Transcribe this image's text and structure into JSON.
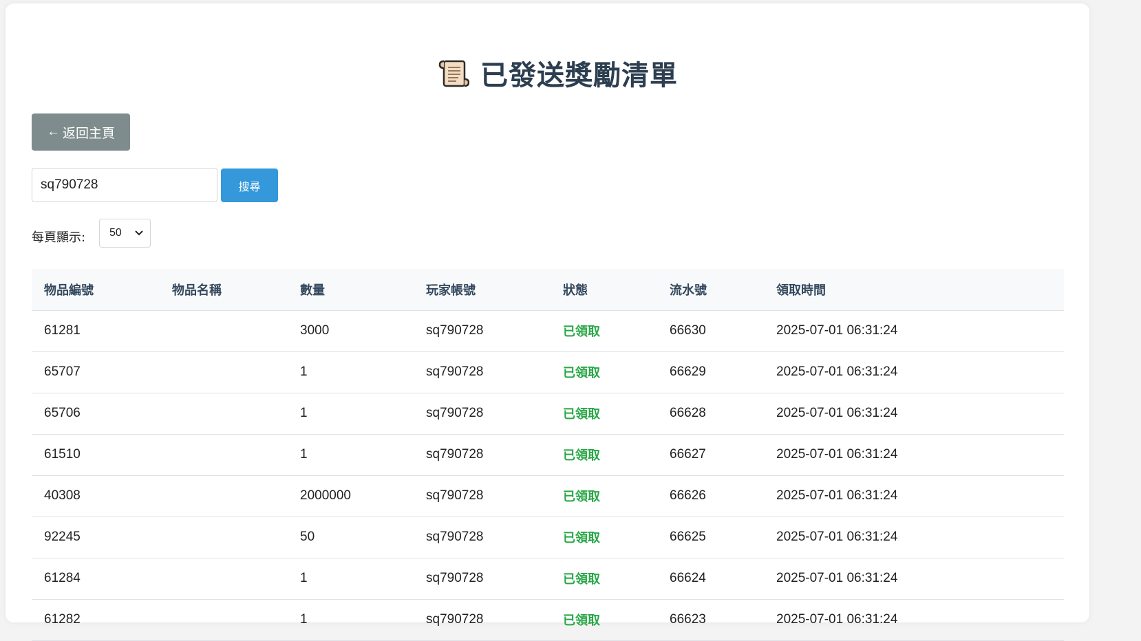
{
  "page": {
    "title": "已發送獎勵清單",
    "title_icon": "scroll-icon"
  },
  "nav": {
    "back_arrow": "←",
    "back_label": "返回主頁"
  },
  "search": {
    "value": "sq790728",
    "button_label": "搜尋"
  },
  "pagination": {
    "per_page_label": "每頁顯示:",
    "per_page_value": "50"
  },
  "table": {
    "headers": [
      "物品編號",
      "物品名稱",
      "數量",
      "玩家帳號",
      "狀態",
      "流水號",
      "領取時間"
    ],
    "rows": [
      {
        "item_id": "61281",
        "item_name": "",
        "qty": "3000",
        "account": "sq790728",
        "status": "已領取",
        "serial": "66630",
        "time": "2025-07-01 06:31:24"
      },
      {
        "item_id": "65707",
        "item_name": "",
        "qty": "1",
        "account": "sq790728",
        "status": "已領取",
        "serial": "66629",
        "time": "2025-07-01 06:31:24"
      },
      {
        "item_id": "65706",
        "item_name": "",
        "qty": "1",
        "account": "sq790728",
        "status": "已領取",
        "serial": "66628",
        "time": "2025-07-01 06:31:24"
      },
      {
        "item_id": "61510",
        "item_name": "",
        "qty": "1",
        "account": "sq790728",
        "status": "已領取",
        "serial": "66627",
        "time": "2025-07-01 06:31:24"
      },
      {
        "item_id": "40308",
        "item_name": "",
        "qty": "2000000",
        "account": "sq790728",
        "status": "已領取",
        "serial": "66626",
        "time": "2025-07-01 06:31:24"
      },
      {
        "item_id": "92245",
        "item_name": "",
        "qty": "50",
        "account": "sq790728",
        "status": "已領取",
        "serial": "66625",
        "time": "2025-07-01 06:31:24"
      },
      {
        "item_id": "61284",
        "item_name": "",
        "qty": "1",
        "account": "sq790728",
        "status": "已領取",
        "serial": "66624",
        "time": "2025-07-01 06:31:24"
      },
      {
        "item_id": "61282",
        "item_name": "",
        "qty": "1",
        "account": "sq790728",
        "status": "已領取",
        "serial": "66623",
        "time": "2025-07-01 06:31:24"
      }
    ]
  },
  "colors": {
    "title": "#2c3e50",
    "back_button_bg": "#7f8c8d",
    "search_button_bg": "#3498db",
    "status_claimed": "#28a745"
  }
}
